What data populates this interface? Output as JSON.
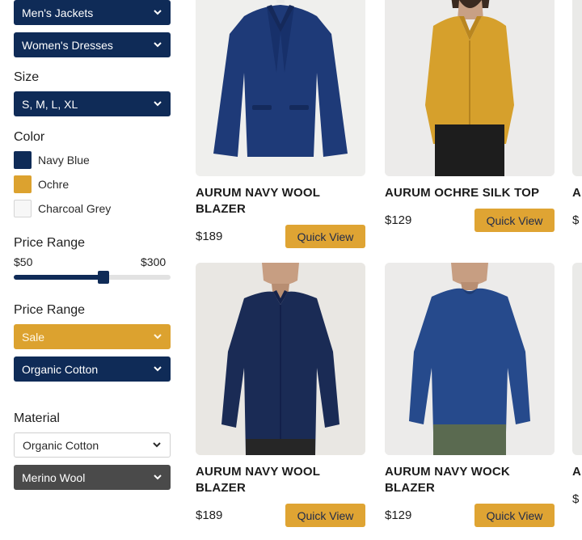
{
  "filters": {
    "top_dropdowns": [
      {
        "label": "Men's Jackets"
      },
      {
        "label": "Women's Dresses"
      }
    ],
    "size": {
      "heading": "Size",
      "value": "S, M, L, XL"
    },
    "color": {
      "heading": "Color",
      "options": [
        {
          "label": "Navy Blue",
          "color": "#0f2b57"
        },
        {
          "label": "Ochre",
          "color": "#dca22f"
        },
        {
          "label": "Charcoal Grey",
          "color": "#f7f7f7"
        }
      ]
    },
    "price_range": {
      "heading": "Price Range",
      "min_label": "$50",
      "max_label": "$300",
      "selected_fraction": 0.57
    },
    "price_range_2": {
      "heading": "Price Range",
      "sale_value": "Sale",
      "cotton_value": "Organic Cotton"
    },
    "material": {
      "heading": "Material",
      "value_1": "Organic Cotton",
      "value_2": "Merino Wool"
    }
  },
  "products": [
    {
      "name": "AURUM NAVY WOOL BLAZER",
      "price": "$189",
      "button": "Quick View",
      "image": "navy-blazer"
    },
    {
      "name": "AURUM OCHRE SILK TOP",
      "price": "$129",
      "button": "Quick View",
      "image": "ochre-silk-top"
    },
    {
      "name": "AURUM NAVY WOOL BLAZER",
      "price": "$189",
      "button": "Quick View",
      "image": "navy-shirt-man"
    },
    {
      "name": "AURUM NAVY WOCK BLAZER",
      "price": "$129",
      "button": "Quick View",
      "image": "navy-sweater-man"
    }
  ],
  "partial_column": {
    "row1_text": "A B",
    "row1_price": "$",
    "row2_text": "A B",
    "row2_price": "$"
  },
  "colors": {
    "navy": "#0f2b57",
    "ochre": "#dca22f",
    "grey_button": "#4a4a4a"
  },
  "icons": {
    "dropdown": "chevron-down-icon"
  }
}
